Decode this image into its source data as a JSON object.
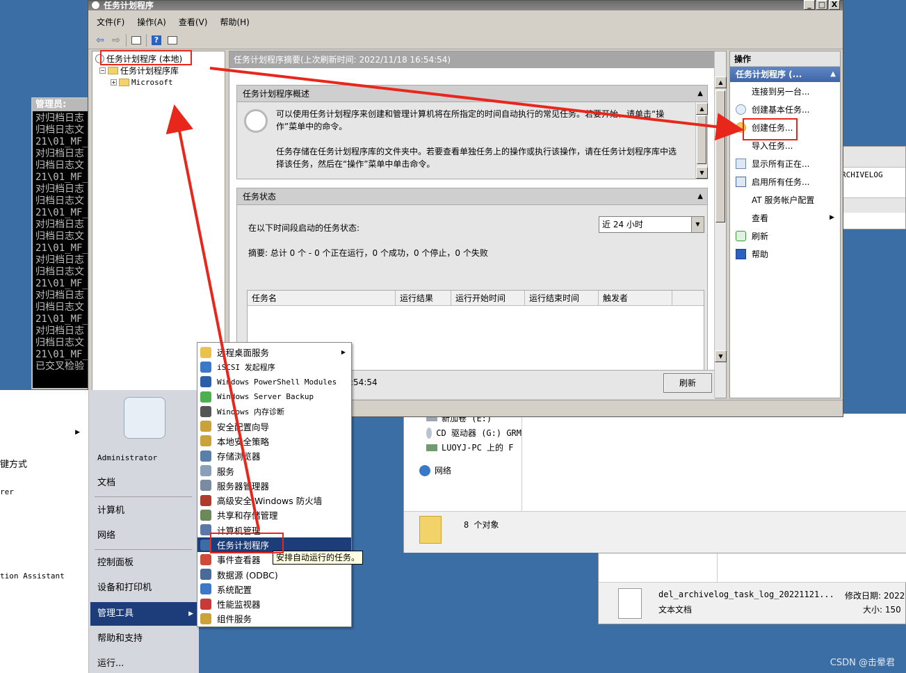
{
  "console": {
    "title": "管理员:",
    "lines": [
      "对归档日志",
      "归档日志文",
      "21\\01_MF_",
      "对归档日志",
      "归档日志文",
      "21\\01_MF_",
      "对归档日志",
      "归档日志文",
      "21\\01_MF_",
      "对归档日志",
      "归档日志文",
      "21\\01_MF_",
      "对归档日志",
      "归档日志文",
      "21\\01_MF_",
      "对归档日志",
      "归档日志文",
      "21\\01_MF_",
      "对归档日志",
      "归档日志文",
      "21\\01_MF_",
      "已交叉检验"
    ]
  },
  "task_scheduler": {
    "title": "任务计划程序",
    "caption_buttons": [
      "_",
      "□",
      "X"
    ],
    "menu": [
      "文件(F)",
      "操作(A)",
      "查看(V)",
      "帮助(H)"
    ],
    "tree": {
      "root": "任务计划程序 (本地)",
      "library": "任务计划程序库",
      "microsoft": "Microsoft"
    },
    "summary_header": "任务计划程序摘要(上次刷新时间: 2022/11/18 16:54:54)",
    "overview": {
      "title": "任务计划程序概述",
      "para1": "可以使用任务计划程序来创建和管理计算机将在所指定的时间自动执行的常见任务。若要开始，请单击“操作”菜单中的命令。",
      "para2": "任务存储在任务计划程序库的文件夹中。若要查看单独任务上的操作或执行该操作，请在任务计划程序库中选择该任务，然后在“操作”菜单中单击命令。"
    },
    "status": {
      "title": "任务状态",
      "period_label": "在以下时间段启动的任务状态:",
      "period_value": "近 24 小时",
      "summary": "摘要: 总计 0 个 - 0 个正在运行，0 个成功，0 个停止，0 个失败",
      "columns": [
        "任务名",
        "运行结果",
        "运行开始时间",
        "运行结束时间",
        "触发者"
      ]
    },
    "last_refresh_fragment": ":54:54",
    "refresh_button": "刷新",
    "actions": {
      "header": "操作",
      "section": "任务计划程序 (...",
      "items": [
        {
          "label": "连接到另一台...",
          "icon": "none"
        },
        {
          "label": "创建基本任务...",
          "icon": "basic-task-icon"
        },
        {
          "label": "创建任务...",
          "icon": "create-task-icon"
        },
        {
          "label": "导入任务...",
          "icon": "none"
        },
        {
          "label": "显示所有正在...",
          "icon": "running-tasks-icon"
        },
        {
          "label": "启用所有任务...",
          "icon": "enable-history-icon"
        },
        {
          "label": "AT 服务帐户配置",
          "icon": "none"
        },
        {
          "label": "查看",
          "icon": "none"
        },
        {
          "label": "刷新",
          "icon": "refresh-icon"
        },
        {
          "label": "帮助",
          "icon": "help-icon"
        }
      ]
    }
  },
  "archive_window": {
    "text": "RCHIVELOG"
  },
  "explorer": {
    "items": [
      "新加卷 (E:)",
      "CD 驱动器 (G:) GRM",
      "LUOYJ-PC 上的 F",
      "网络"
    ],
    "object_count": "8 个对象"
  },
  "file_window": {
    "filename": "del_archivelog_task_log_20221121...",
    "filetype": "文本文档",
    "modified_label": "修改日期: 2022",
    "size_label": "大小: 150"
  },
  "start_menu": {
    "left_items": [
      "键方式",
      "rer",
      "tion Assistant"
    ],
    "right_items": [
      "Administrator",
      "文档",
      "计算机",
      "网络",
      "控制面板",
      "设备和打印机",
      "管理工具",
      "帮助和支持",
      "运行..."
    ]
  },
  "admin_tools": {
    "items": [
      {
        "label": "远程桌面服务",
        "color": "#e8c24a",
        "submenu": true
      },
      {
        "label": "iSCSI 发起程序",
        "color": "#3a78c8"
      },
      {
        "label": "Windows PowerShell Modules",
        "color": "#2d5ea8"
      },
      {
        "label": "Windows Server Backup",
        "color": "#4caf50"
      },
      {
        "label": "Windows 内存诊断",
        "color": "#555555"
      },
      {
        "label": "安全配置向导",
        "color": "#c9a33a"
      },
      {
        "label": "本地安全策略",
        "color": "#c9a33a"
      },
      {
        "label": "存储浏览器",
        "color": "#5a7fa8"
      },
      {
        "label": "服务",
        "color": "#8aa0b8"
      },
      {
        "label": "服务器管理器",
        "color": "#7a8aa0"
      },
      {
        "label": "高级安全 Windows 防火墙",
        "color": "#b03a2e"
      },
      {
        "label": "共享和存储管理",
        "color": "#6a8a5a"
      },
      {
        "label": "计算机管理",
        "color": "#5a78a8"
      },
      {
        "label": "任务计划程序",
        "color": "#3a6ea5",
        "highlighted": true
      },
      {
        "label": "事件查看器",
        "color": "#d04a3a"
      },
      {
        "label": "数据源 (ODBC)",
        "color": "#4a6a9a"
      },
      {
        "label": "系统配置",
        "color": "#3a78c8"
      },
      {
        "label": "性能监视器",
        "color": "#c83a3a"
      },
      {
        "label": "组件服务",
        "color": "#c9a33a"
      }
    ],
    "tooltip": "安排自动运行的任务。"
  },
  "watermark": "CSDN @击晕君",
  "colors": {
    "desktop": "#3a6ea5",
    "highlight": "#1d3d7a",
    "annotation": "#e8261c"
  }
}
